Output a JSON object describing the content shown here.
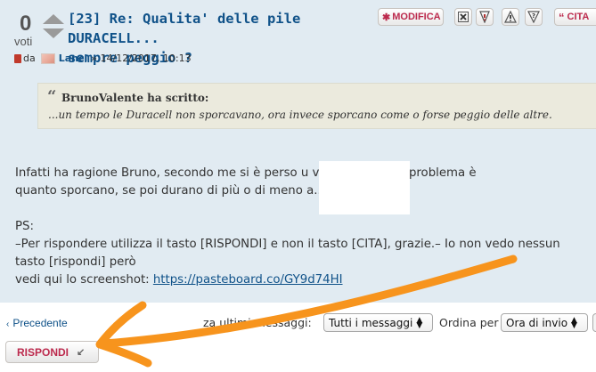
{
  "vote": {
    "count": "0",
    "label": "voti"
  },
  "post": {
    "title_line1": "[23] Re: Qualita' delle pile DURACELL...",
    "title_line2": "sempre peggio ?",
    "author_prefix": "da",
    "author_name": "Lanci",
    "timestamp": "» 14/12/2017, 10:13"
  },
  "toolbar": {
    "edit_label": "MODIFICA",
    "quote_label": "CITA"
  },
  "quote": {
    "mark": "“",
    "author_line": "BrunoValente ha scritto:",
    "text": "...un tempo le Duracell non sporcavano, ora invece sporcano come o forse peggio delle altre."
  },
  "body": {
    "line1": "Infatti ha ragione Bruno, secondo me si è perso u                        vo del thread, il problema è",
    "line2": "quanto sporcano, se poi durano di più o di meno                        a...",
    "line3": "PS:",
    "line4": "–Per rispondere utilizza il tasto [RISPONDI] e non il tasto [CITA], grazie.– Io non vedo nessun",
    "line5": "tasto [rispondi] però",
    "line6_prefix": "vedi qui lo screenshot: ",
    "link_text": "https://pasteboard.co/GY9d74HI"
  },
  "nav": {
    "previous_label": "Precedente",
    "display_label": "za ultimi messaggi:",
    "display_value": "Tutti i messaggi",
    "sort_label": "Ordina per",
    "sort_value": "Ora di invio"
  },
  "reply_button": {
    "label": "RISPONDI"
  },
  "colors": {
    "panel_bg": "#e1ebf2",
    "link": "#105289",
    "button_text": "#bc2a4d",
    "annotation": "#f7941d"
  },
  "icons": {
    "toolbar": [
      "delete-icon",
      "warning-icon",
      "report-icon",
      "info-icon"
    ],
    "reply": "reply-arrow-icon"
  }
}
